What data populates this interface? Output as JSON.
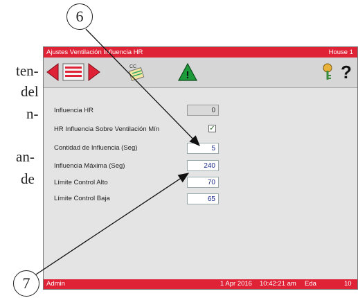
{
  "manual": {
    "lines": [
      "ten-",
      "del",
      "n-",
      "an-",
      "de"
    ]
  },
  "callouts": {
    "six": "6",
    "seven": "7"
  },
  "titlebar": {
    "title": "Ajustes Ventilación Influencia HR",
    "house": "House 1"
  },
  "toolbar": {
    "icons": [
      "prev-arrow-icon",
      "list-icon",
      "next-arrow-icon",
      "cc-settings-icon",
      "warning-icon",
      "key-icon",
      "help-icon"
    ],
    "help_label": "?",
    "cc_label": "CC",
    "warning_label": "!"
  },
  "form": {
    "influence_hr_label": "Influencia HR",
    "influence_hr_value": "0",
    "hr_vent_min_label": "HR Influencia Sobre Ventilación Mín",
    "hr_vent_min_checked": true,
    "check_mark": "✓",
    "influence_amount_label": "Contidad de Influencia (Seg)",
    "influence_amount_value": "5",
    "influence_max_label": "Influencia Máxima (Seg)",
    "influence_max_value": "240",
    "control_high_label": "Límite Control Alto",
    "control_high_value": "70",
    "control_low_label": "Límite Control Baja",
    "control_low_value": "65"
  },
  "status": {
    "user": "Admin",
    "date": "1 Apr 2016",
    "time": "10:42:21 am",
    "mode": "Eda",
    "count": "10"
  },
  "colors": {
    "accent": "#e02236",
    "screen_bg": "#e4e4e4",
    "value_text": "#1c2a8a"
  }
}
